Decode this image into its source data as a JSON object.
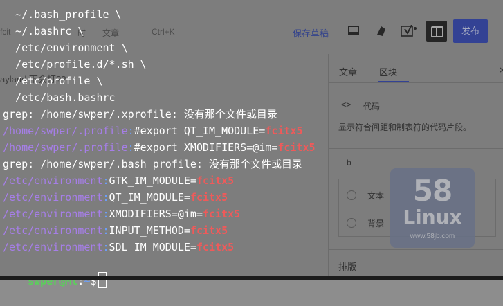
{
  "editor": {
    "toolbar": {
      "partial_left_1": "fcit",
      "partial_left_2": "时",
      "tab_article": "文章",
      "shortcut": "Ctrl+K",
      "save_draft": "保存草稿",
      "publish": "发布"
    },
    "bg_partial_line": "ayland 下会打??",
    "sidebar": {
      "tab_article": "文章",
      "tab_block": "区块",
      "block_title": "代码",
      "block_icon_glyph": "<>",
      "block_desc": "显示符合间距和制表符的代码片段。",
      "style_letter": "b",
      "option_text": "文本",
      "option_background": "背景",
      "typeset": "排版",
      "close": "×"
    }
  },
  "watermark": {
    "line1": "58",
    "line2": "Linux",
    "url": "www.58jb.com"
  },
  "terminal": {
    "lines": [
      {
        "plain": "  ~/.bash_profile \\"
      },
      {
        "plain": "  ~/.bashrc \\"
      },
      {
        "plain": "  /etc/environment \\"
      },
      {
        "plain": "  /etc/profile.d/*.sh \\"
      },
      {
        "plain": "  /etc/profile \\"
      },
      {
        "plain": "  /etc/bash.bashrc"
      },
      {
        "plain": "grep: /home/swper/.xprofile: 没有那个文件或目录"
      },
      {
        "file": "/home/swper/.profile",
        "sep": ":",
        "text": "#export QT_IM_MODULE=",
        "match": "fcitx5"
      },
      {
        "file": "/home/swper/.profile",
        "sep": ":",
        "text": "#export XMODIFIERS=@im=",
        "match": "fcitx5"
      },
      {
        "plain": "grep: /home/swper/.bash_profile: 没有那个文件或目录"
      },
      {
        "file": "/etc/environment",
        "sep": ":",
        "text": "GTK_IM_MODULE=",
        "match": "fcitx5"
      },
      {
        "file": "/etc/environment",
        "sep": ":",
        "text": "QT_IM_MODULE=",
        "match": "fcitx5"
      },
      {
        "file": "/etc/environment",
        "sep": ":",
        "text": "XMODIFIERS=@im=",
        "match": "fcitx5"
      },
      {
        "file": "/etc/environment",
        "sep": ":",
        "text": "INPUT_METHOD=",
        "match": "fcitx5"
      },
      {
        "file": "/etc/environment",
        "sep": ":",
        "text": "SDL_IM_MODULE=",
        "match": "fcitx5"
      }
    ],
    "prompt": {
      "user_host": "swper@Mt",
      "sep": ":",
      "path": "~",
      "symbol": "$"
    }
  },
  "colors": {
    "file": "#a67ee8",
    "match": "#ef5a5a",
    "prompt": "#5ad05a",
    "path": "#6aa0ff"
  }
}
